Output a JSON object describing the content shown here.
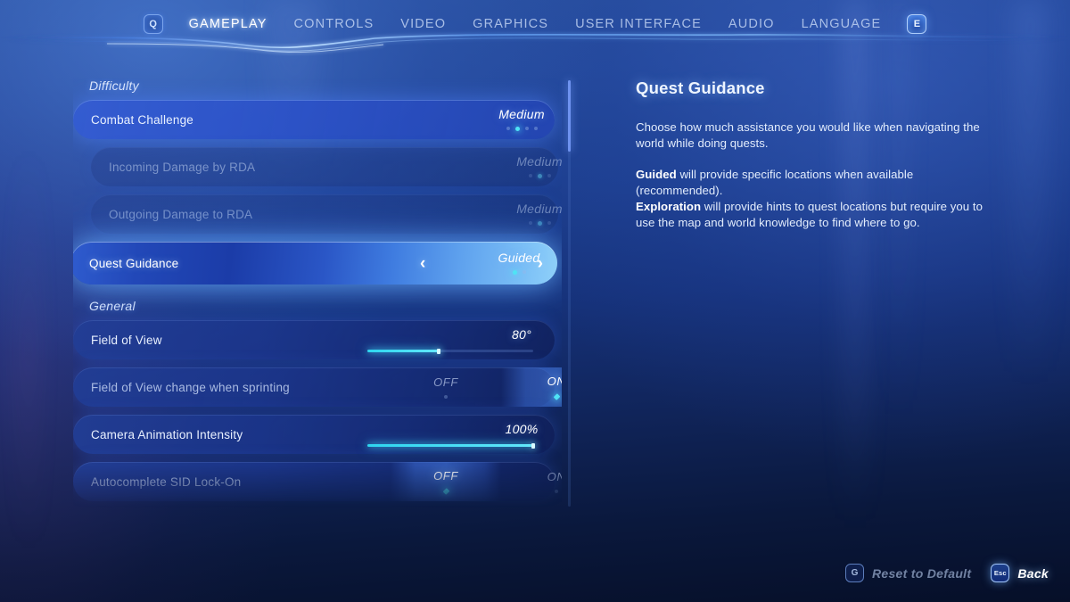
{
  "header": {
    "prev_key": "Q",
    "next_key": "E",
    "tabs": [
      {
        "label": "GAMEPLAY",
        "active": true
      },
      {
        "label": "CONTROLS",
        "active": false
      },
      {
        "label": "VIDEO",
        "active": false
      },
      {
        "label": "GRAPHICS",
        "active": false
      },
      {
        "label": "USER INTERFACE",
        "active": false
      },
      {
        "label": "AUDIO",
        "active": false
      },
      {
        "label": "LANGUAGE",
        "active": false
      }
    ]
  },
  "settings": {
    "groups": [
      {
        "title": "Difficulty"
      },
      {
        "title": "General"
      }
    ],
    "rows": [
      {
        "label": "Combat Challenge",
        "value": "Medium",
        "type": "stepper",
        "dots": 4,
        "dot_index": 1,
        "state": "highlight"
      },
      {
        "label": "Incoming Damage by RDA",
        "value": "Medium",
        "type": "stepper",
        "dots": 3,
        "dot_index": 1,
        "state": "disabled"
      },
      {
        "label": "Outgoing Damage to RDA",
        "value": "Medium",
        "type": "stepper",
        "dots": 3,
        "dot_index": 1,
        "state": "disabled"
      },
      {
        "label": "Quest Guidance",
        "value": "Guided",
        "type": "stepper",
        "dots": 2,
        "dot_index": 0,
        "state": "selected",
        "prev_arrow": "‹",
        "next_arrow": "›"
      },
      {
        "label": "Field of View",
        "value": "80°",
        "type": "slider",
        "percent": 43,
        "state": "normal"
      },
      {
        "label": "Field of View change when sprinting",
        "type": "toggle",
        "options": [
          "OFF",
          "ON"
        ],
        "selected_index": 1,
        "state": "normal"
      },
      {
        "label": "Camera Animation Intensity",
        "value": "100%",
        "type": "slider",
        "percent": 100,
        "state": "normal"
      },
      {
        "label": "Autocomplete SID Lock-On",
        "type": "toggle",
        "options": [
          "OFF",
          "ON"
        ],
        "selected_index": 0,
        "state": "normal"
      }
    ]
  },
  "info": {
    "title": "Quest Guidance",
    "paragraph1": "Choose how much assistance you would like when navigating the world while doing quests.",
    "line_guided_bold": "Guided",
    "line_guided_rest": " will provide specific locations when available (recommended).",
    "line_exploration_bold": "Exploration",
    "line_exploration_rest": " will provide hints to quest locations but require you to use the map and world knowledge to find where to go."
  },
  "footer": {
    "reset_key": "G",
    "reset_label": "Reset to Default",
    "back_key": "Esc",
    "back_label": "Back"
  },
  "colors": {
    "accent_cyan": "#4fe3f5",
    "selected_blue": "#3f7ce0",
    "background_blue": "#1d3f8e"
  }
}
